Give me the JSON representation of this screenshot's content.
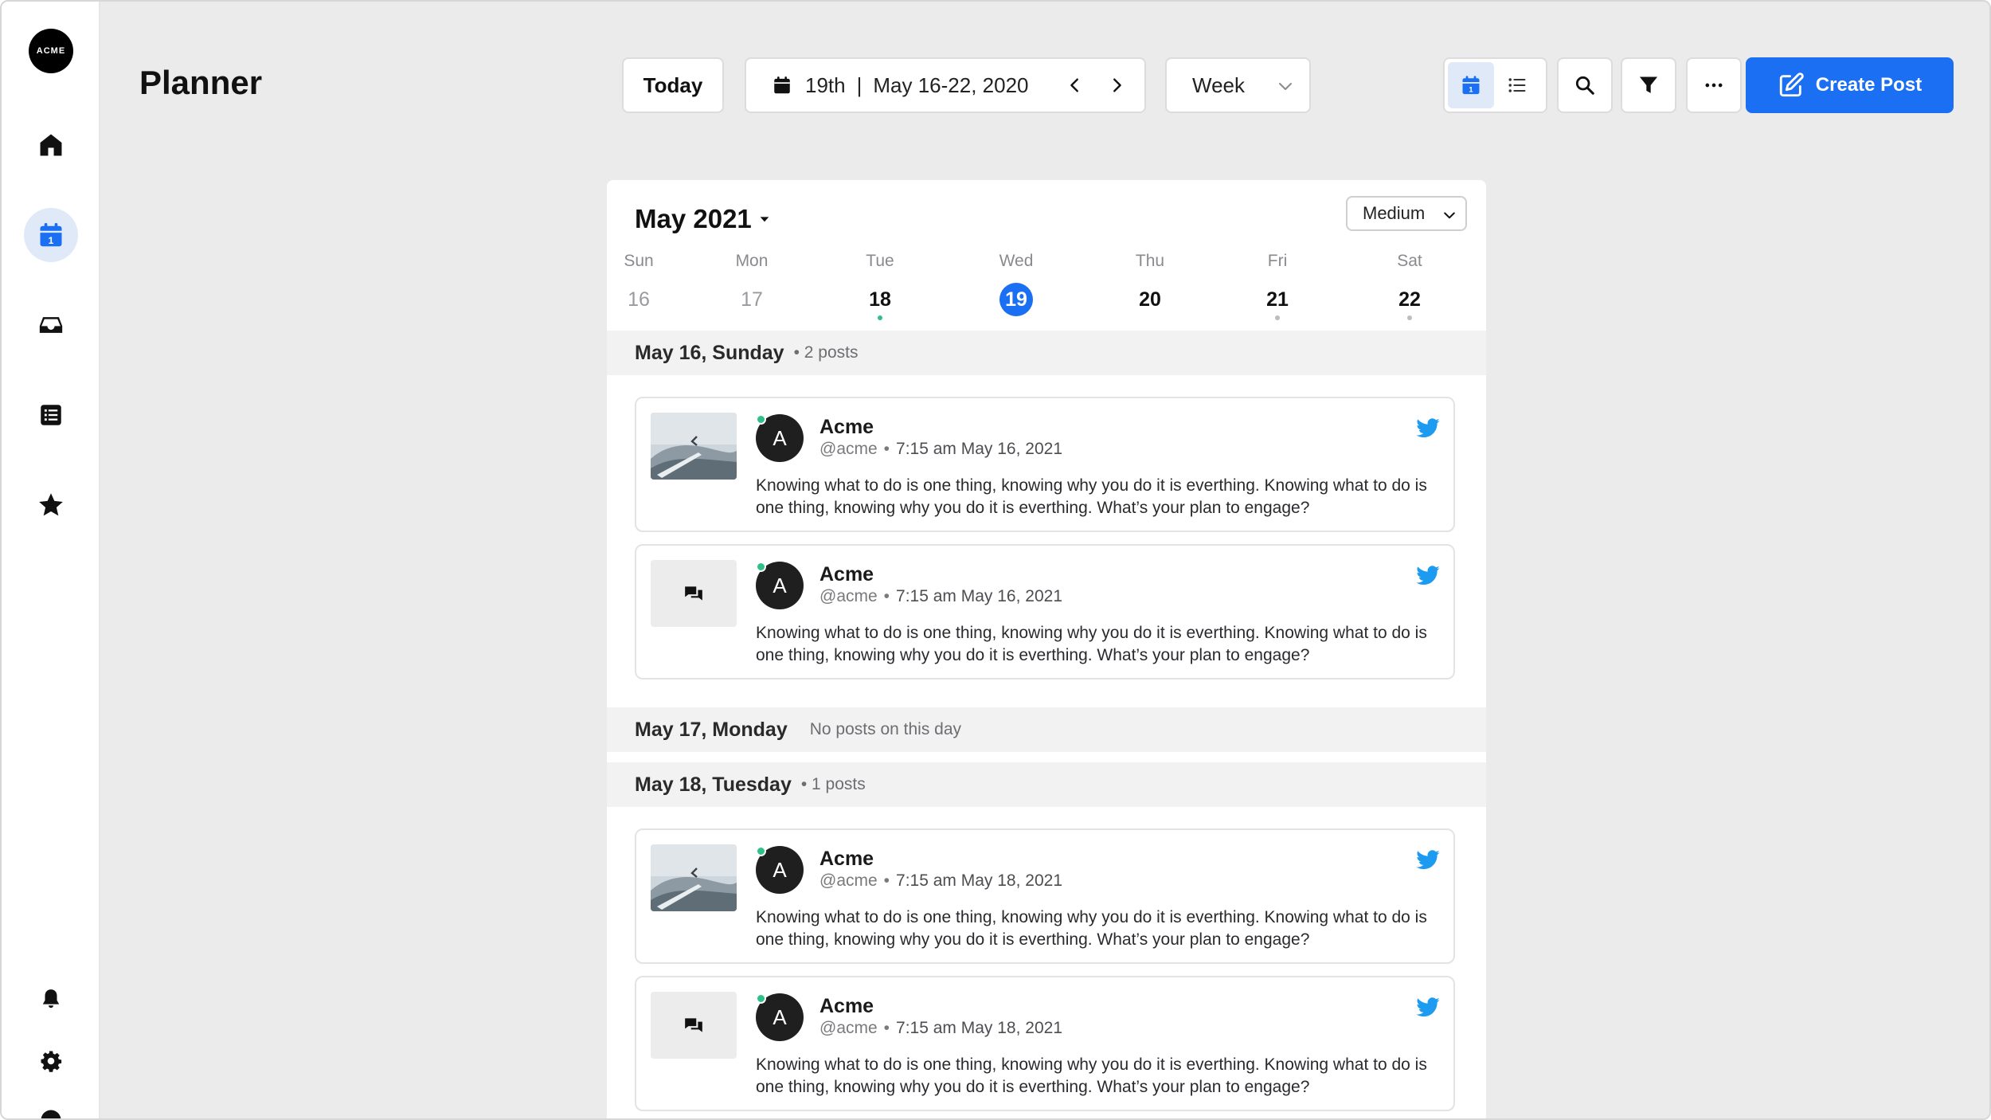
{
  "brand": {
    "logo_text": "ACME"
  },
  "sidebar": {
    "items": [
      {
        "icon": "home-icon"
      },
      {
        "icon": "calendar-icon",
        "active": true
      },
      {
        "icon": "inbox-icon"
      },
      {
        "icon": "list-icon"
      },
      {
        "icon": "star-icon"
      }
    ],
    "bottom_items": [
      {
        "icon": "bell-icon"
      },
      {
        "icon": "gear-icon"
      }
    ]
  },
  "header": {
    "title": "Planner",
    "today_label": "Today",
    "date_day": "19th",
    "date_separator": "|",
    "date_range": "May 16-22, 2020",
    "view_select": "Week",
    "create_label": "Create Post"
  },
  "colors": {
    "accent": "#1b6ff2",
    "online": "#2fc08a",
    "twitter": "#1d9bf0"
  },
  "calendar": {
    "month_label": "May 2021",
    "density_select": "Medium",
    "days": [
      {
        "name": "Sun",
        "num": "16"
      },
      {
        "name": "Mon",
        "num": "17"
      },
      {
        "name": "Tue",
        "num": "18"
      },
      {
        "name": "Wed",
        "num": "19"
      },
      {
        "name": "Thu",
        "num": "20"
      },
      {
        "name": "Fri",
        "num": "21"
      },
      {
        "name": "Sat",
        "num": "22"
      }
    ]
  },
  "sections": [
    {
      "title": "May 16, Sunday",
      "meta": "• 2 posts"
    },
    {
      "title": "May 17, Monday",
      "meta": "No posts on this day"
    },
    {
      "title": "May 18, Tuesday",
      "meta": "• 1 posts"
    }
  ],
  "posts": [
    {
      "account": "Acme",
      "handle": "@acme",
      "bullet": "•",
      "time": "7:15 am May 16, 2021",
      "avatar": "A",
      "media": "image",
      "text": "Knowing what to do is one thing, knowing why you do it is everthing. Knowing what to do is one thing, knowing why you do it is everthing. What’s your plan to engage?"
    },
    {
      "account": "Acme",
      "handle": "@acme",
      "bullet": "•",
      "time": "7:15 am May 16, 2021",
      "avatar": "A",
      "media": "text",
      "text": "Knowing what to do is one thing, knowing why you do it is everthing. Knowing what to do is one thing, knowing why you do it is everthing. What’s your plan to engage?"
    },
    {
      "account": "Acme",
      "handle": "@acme",
      "bullet": "•",
      "time": "7:15 am May 18, 2021",
      "avatar": "A",
      "media": "image",
      "text": "Knowing what to do is one thing, knowing why you do it is everthing. Knowing what to do is one thing, knowing why you do it is everthing. What’s your plan to engage?"
    },
    {
      "account": "Acme",
      "handle": "@acme",
      "bullet": "•",
      "time": "7:15 am May 18, 2021",
      "avatar": "A",
      "media": "text",
      "text": "Knowing what to do is one thing, knowing why you do it is everthing. Knowing what to do is one thing, knowing why you do it is everthing. What’s your plan to engage?"
    }
  ]
}
